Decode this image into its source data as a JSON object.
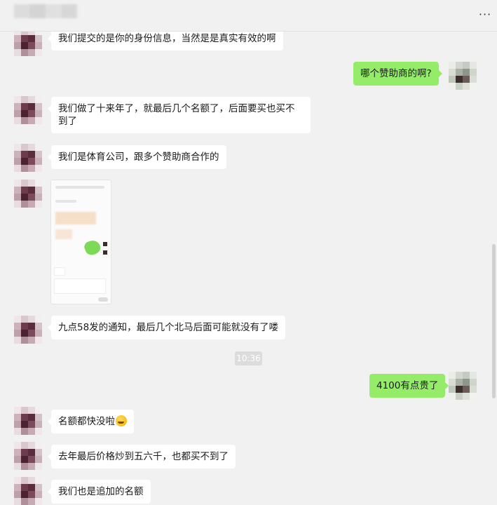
{
  "header": {
    "more_label": "···"
  },
  "messages": [
    {
      "side": "left",
      "text": "我们提交的是你的身份信息，当然是是真实有效的啊"
    },
    {
      "side": "right",
      "text": "哪个赞助商的啊?"
    },
    {
      "side": "left",
      "text": "我们做了十来年了，就最后几个名额了，后面要买也买不到了"
    },
    {
      "side": "left",
      "text": "我们是体育公司，跟多个赞助商合作的"
    },
    {
      "side": "left",
      "type": "image"
    },
    {
      "side": "left",
      "text": "九点58发的通知，最后几个北马后面可能就没有了喽"
    },
    {
      "type": "time",
      "text": "10:36"
    },
    {
      "side": "right",
      "text": "4100有点贵了"
    },
    {
      "side": "left",
      "text": "名额都快没啦",
      "emoji": "laughing-crying-emoji"
    },
    {
      "side": "left",
      "text": "去年最后价格炒到五六千，也都买不到了"
    },
    {
      "side": "left",
      "text": "我们也是追加的名额"
    }
  ],
  "colors": {
    "background": "#f1f1f1",
    "bubble_self": "#95ec69",
    "bubble_other": "#ffffff"
  }
}
